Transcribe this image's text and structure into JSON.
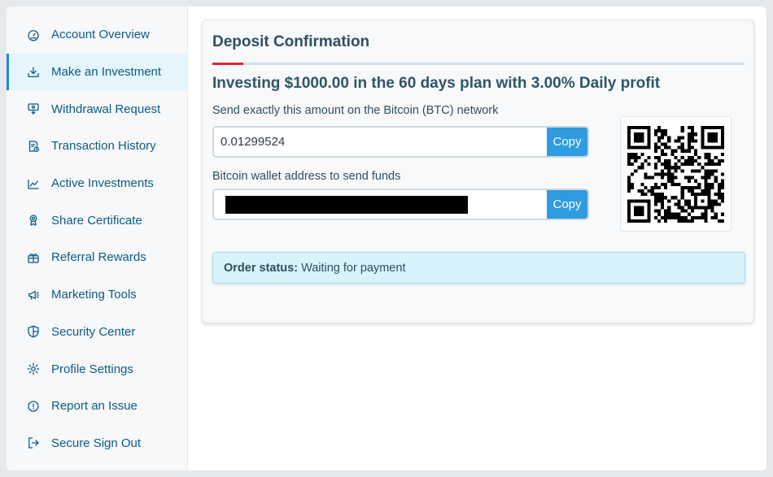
{
  "sidebar": {
    "items": [
      {
        "label": "Account Overview",
        "icon": "gauge-icon"
      },
      {
        "label": "Make an Investment",
        "icon": "download-tray-icon",
        "active": true
      },
      {
        "label": "Withdrawal Request",
        "icon": "withdraw-icon"
      },
      {
        "label": "Transaction History",
        "icon": "history-doc-icon"
      },
      {
        "label": "Active Investments",
        "icon": "chart-hand-icon"
      },
      {
        "label": "Share Certificate",
        "icon": "award-icon"
      },
      {
        "label": "Referral Rewards",
        "icon": "gift-icon"
      },
      {
        "label": "Marketing Tools",
        "icon": "megaphone-icon"
      },
      {
        "label": "Security Center",
        "icon": "shield-icon"
      },
      {
        "label": "Profile Settings",
        "icon": "gear-icon"
      },
      {
        "label": "Report an Issue",
        "icon": "alert-circle-icon"
      },
      {
        "label": "Secure Sign Out",
        "icon": "sign-out-icon"
      }
    ]
  },
  "card": {
    "title": "Deposit Confirmation",
    "plan_heading": "Investing $1000.00 in the 60 days plan with 3.00% Daily profit",
    "amount": {
      "label": "Send exactly this amount on the Bitcoin (BTC) network",
      "value": "0.01299524",
      "copy_label": "Copy"
    },
    "address": {
      "label": "Bitcoin wallet address to send funds",
      "copy_label": "Copy"
    },
    "status": {
      "label": "Order status:",
      "value": "Waiting for payment"
    }
  },
  "colors": {
    "accent": "#2f9be0",
    "nav_text": "#0e5a85",
    "title_accent": "#e3243b",
    "alert_bg": "#d8f3fc"
  }
}
